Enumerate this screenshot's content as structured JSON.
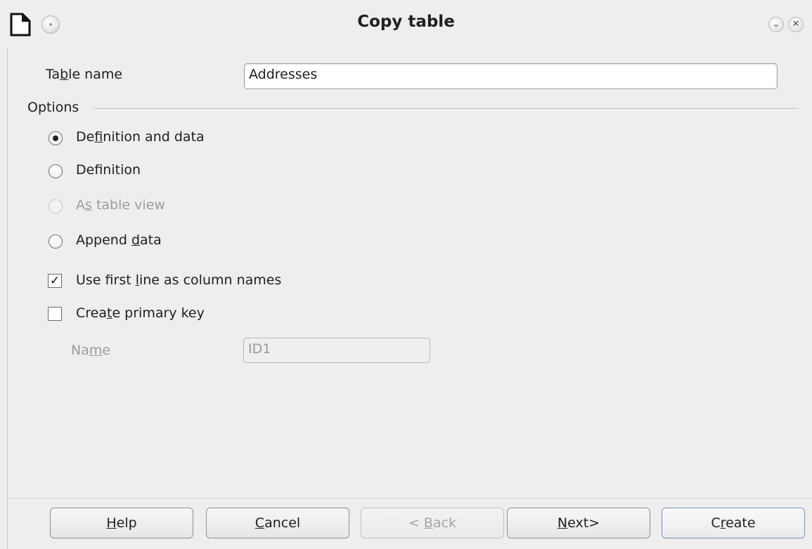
{
  "window": {
    "title": "Copy table",
    "controls": {
      "minimize_icon": "chevron-down-icon",
      "close_icon": "close-icon"
    }
  },
  "table_name": {
    "label_pre": "Ta",
    "label_key": "b",
    "label_post": "le name",
    "value": "Addresses"
  },
  "options": {
    "heading": "Options",
    "radios": [
      {
        "pre": "De",
        "key": "f",
        "post": "inition and data",
        "checked": true,
        "enabled": true
      },
      {
        "pre": "Def",
        "key": "i",
        "post": "nition",
        "checked": false,
        "enabled": true
      },
      {
        "pre": "A",
        "key": "s",
        "post": " table view",
        "checked": false,
        "enabled": false
      },
      {
        "pre": "Append ",
        "key": "d",
        "post": "ata",
        "checked": false,
        "enabled": true
      }
    ],
    "checkboxes": [
      {
        "pre": "Use first ",
        "key": "l",
        "post": "ine as column names",
        "checked": true,
        "mark": "✓"
      },
      {
        "pre": "Crea",
        "key": "t",
        "post": "e primary key",
        "checked": false,
        "mark": ""
      }
    ],
    "name_field": {
      "pre": "Na",
      "key": "m",
      "post": "e",
      "value": "ID1",
      "enabled": false
    }
  },
  "buttons": {
    "help": {
      "pre": "",
      "key": "H",
      "post": "elp"
    },
    "cancel": {
      "pre": "",
      "key": "C",
      "post": "ancel"
    },
    "back": {
      "pre": "< ",
      "key": "B",
      "post": "ack"
    },
    "next": {
      "pre": "",
      "key": "N",
      "post": "ext>"
    },
    "create": {
      "pre": "C",
      "key": "r",
      "post": "eate"
    }
  }
}
